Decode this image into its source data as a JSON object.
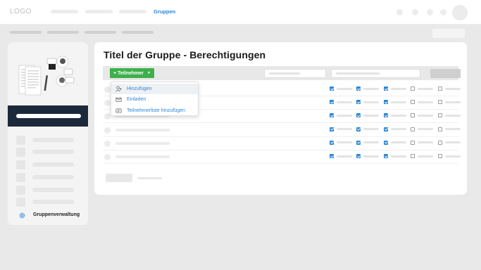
{
  "topbar": {
    "logo": "LOGO",
    "active_nav": "Gruppen",
    "colors": {
      "accent": "#2b86d9"
    }
  },
  "sidebar": {
    "footer_label": "Gruppenverwaltung",
    "footer_icon": "gear-icon",
    "band_color": "#1b2a3a"
  },
  "main": {
    "title": "Titel der Gruppe - Berechtigungen",
    "add_button_label": "+ Teilnehmer",
    "add_button_color": "#3eb04b",
    "dropdown": [
      {
        "label": "Hinzufügen",
        "icon": "add-user-icon"
      },
      {
        "label": "Einladen",
        "icon": "mail-icon"
      },
      {
        "label": "Teilnehmerliste hinzufügen",
        "icon": "list-import-icon"
      }
    ],
    "rows_checked": [
      [
        true,
        true,
        true,
        false,
        false
      ],
      [
        true,
        true,
        true,
        false,
        false
      ],
      [
        true,
        true,
        true,
        false,
        false
      ],
      [
        true,
        true,
        true,
        false,
        false
      ],
      [
        true,
        true,
        true,
        false,
        false
      ],
      [
        true,
        true,
        true,
        false,
        false
      ]
    ]
  }
}
